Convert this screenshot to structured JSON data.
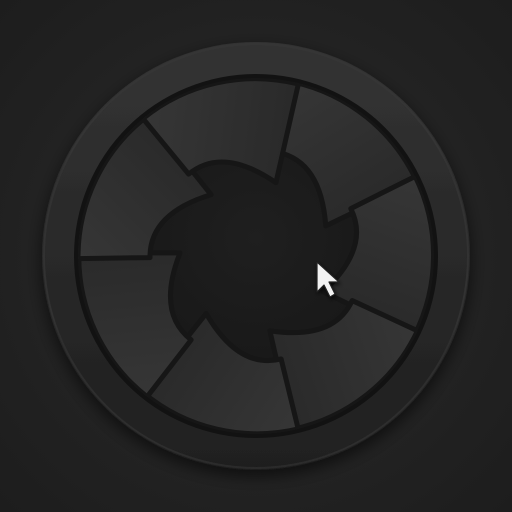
{
  "icon": {
    "name": "aperture-line-selector-icon",
    "palette": {
      "background": "#232323",
      "ring_outer": "#2a2a2a",
      "ring_inner": "#1e1e1e",
      "blade": "#2f2f2f",
      "blade_edge": "#161616",
      "center": "#181818",
      "line": "#dcdcdc",
      "highlight": "#ffa514",
      "cursor": "#f2f2f2"
    },
    "lines": [
      {
        "name": "text-line-1",
        "fill": 1.0,
        "highlighted": false
      },
      {
        "name": "text-line-2",
        "fill": 1.0,
        "highlighted": false
      },
      {
        "name": "text-line-highlighted",
        "fill": 1.0,
        "highlighted": true
      },
      {
        "name": "text-line-4",
        "fill": 0.76,
        "highlighted": false
      },
      {
        "name": "text-line-5",
        "fill": 0.32,
        "highlighted": false
      }
    ],
    "cursor_icon": "mouse-pointer-icon"
  }
}
